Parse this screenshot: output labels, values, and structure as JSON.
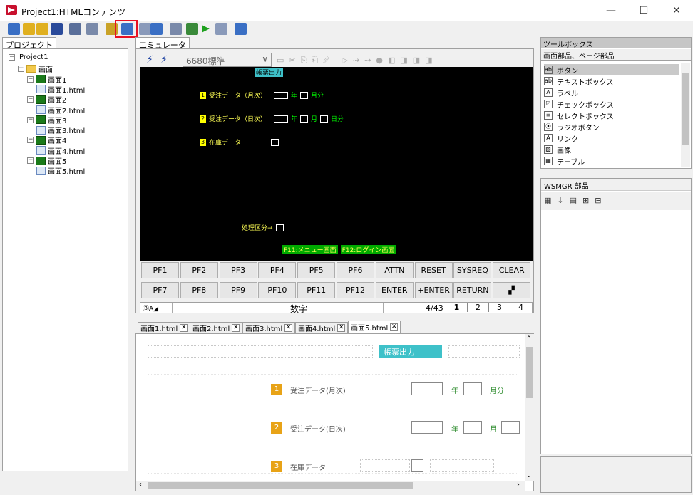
{
  "window": {
    "title": "Project1:HTMLコンテンツ",
    "minimize": "—",
    "maximize": "☐",
    "close": "✕"
  },
  "toolbar": {
    "items": [
      "new-icon",
      "open-icon",
      "open-folder-icon",
      "save-icon",
      "copy-screen-icon",
      "grid-icon",
      "new-page-icon",
      "screen-form-icon",
      "window-icon",
      "table-icon",
      "import-icon",
      "run-config-icon",
      "play-icon",
      "stop-icon",
      "help-icon"
    ],
    "highlighted_index": 7,
    "highlight_color": "#e81123"
  },
  "project": {
    "tab": "プロジェクト",
    "tree": [
      {
        "label": "Project1",
        "level": 0,
        "icon": "project"
      },
      {
        "label": "画面",
        "level": 1,
        "icon": "folder"
      },
      {
        "label": "画面1",
        "level": 2,
        "icon": "screen"
      },
      {
        "label": "画面1.html",
        "level": 3,
        "icon": "html"
      },
      {
        "label": "画面2",
        "level": 2,
        "icon": "screen"
      },
      {
        "label": "画面2.html",
        "level": 3,
        "icon": "html"
      },
      {
        "label": "画面3",
        "level": 2,
        "icon": "screen"
      },
      {
        "label": "画面3.html",
        "level": 3,
        "icon": "html"
      },
      {
        "label": "画面4",
        "level": 2,
        "icon": "screen"
      },
      {
        "label": "画面4.html",
        "level": 3,
        "icon": "html"
      },
      {
        "label": "画面5",
        "level": 2,
        "icon": "screen"
      },
      {
        "label": "画面5.html",
        "level": 3,
        "icon": "html"
      }
    ]
  },
  "emulator": {
    "tab": "エミュレータ",
    "mode_select": "6680標準",
    "screen": {
      "title": "帳票出力",
      "row1": {
        "num": "1",
        "label": "受注データ（月次）",
        "u1": "年",
        "u2": "月分"
      },
      "row2": {
        "num": "2",
        "label": "受注データ（日次）",
        "u1": "年",
        "u2": "月",
        "u3": "日分"
      },
      "row3": {
        "num": "3",
        "label": "在庫データ"
      },
      "proc": "処理区分→",
      "f11": "F11:メニュー画面",
      "f12": "F12:ログイン画面"
    },
    "keys_row1": [
      "PF1",
      "PF2",
      "PF3",
      "PF4",
      "PF5",
      "PF6",
      "ATTN",
      "RESET",
      "SYSREQ",
      "CLEAR"
    ],
    "keys_row2": [
      "PF7",
      "PF8",
      "PF9",
      "PF10",
      "PF11",
      "PF12",
      "ENTER",
      "+ENTER",
      "RETURN"
    ],
    "status": {
      "left": "ⒷA◢",
      "mode": "数字",
      "pos": "4/43",
      "pages": [
        "1",
        "2",
        "3",
        "4"
      ]
    }
  },
  "editor": {
    "tabs": [
      {
        "label": "画面1.html",
        "active": false
      },
      {
        "label": "画面2.html",
        "active": false
      },
      {
        "label": "画面3.html",
        "active": false
      },
      {
        "label": "画面4.html",
        "active": false
      },
      {
        "label": "画面5.html",
        "active": true
      }
    ],
    "title": "帳票出力",
    "title_color": "#3ec1c9",
    "rows": [
      {
        "num": "1",
        "label": "受注データ(月次)",
        "u1": "年",
        "u2": "月分"
      },
      {
        "num": "2",
        "label": "受注データ(日次)",
        "u1": "年",
        "u2": "月"
      },
      {
        "num": "3",
        "label": "在庫データ"
      }
    ]
  },
  "toolbox": {
    "header": "ツールボックス",
    "subheader": "画面部品、ページ部品",
    "items": [
      {
        "icon": "ab",
        "label": "ボタン",
        "selected": true
      },
      {
        "icon": "abl",
        "label": "テキストボックス",
        "selected": false
      },
      {
        "icon": "A",
        "label": "ラベル",
        "selected": false
      },
      {
        "icon": "☑",
        "label": "チェックボックス",
        "selected": false
      },
      {
        "icon": "≡",
        "label": "セレクトボックス",
        "selected": false
      },
      {
        "icon": "⦿",
        "label": "ラジオボタン",
        "selected": false
      },
      {
        "icon": "A",
        "label": "リンク",
        "selected": false
      },
      {
        "icon": "▨",
        "label": "画像",
        "selected": false
      },
      {
        "icon": "▦",
        "label": "テーブル",
        "selected": false
      }
    ]
  },
  "wsmgr": {
    "header": "WSMGR 部品"
  }
}
